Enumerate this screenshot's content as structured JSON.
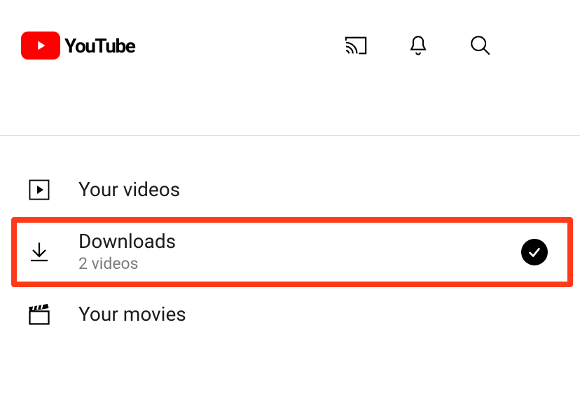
{
  "header": {
    "brand": "YouTube"
  },
  "library": {
    "your_videos": {
      "label": "Your videos"
    },
    "downloads": {
      "label": "Downloads",
      "sub": "2 videos"
    },
    "your_movies": {
      "label": "Your movies"
    }
  }
}
